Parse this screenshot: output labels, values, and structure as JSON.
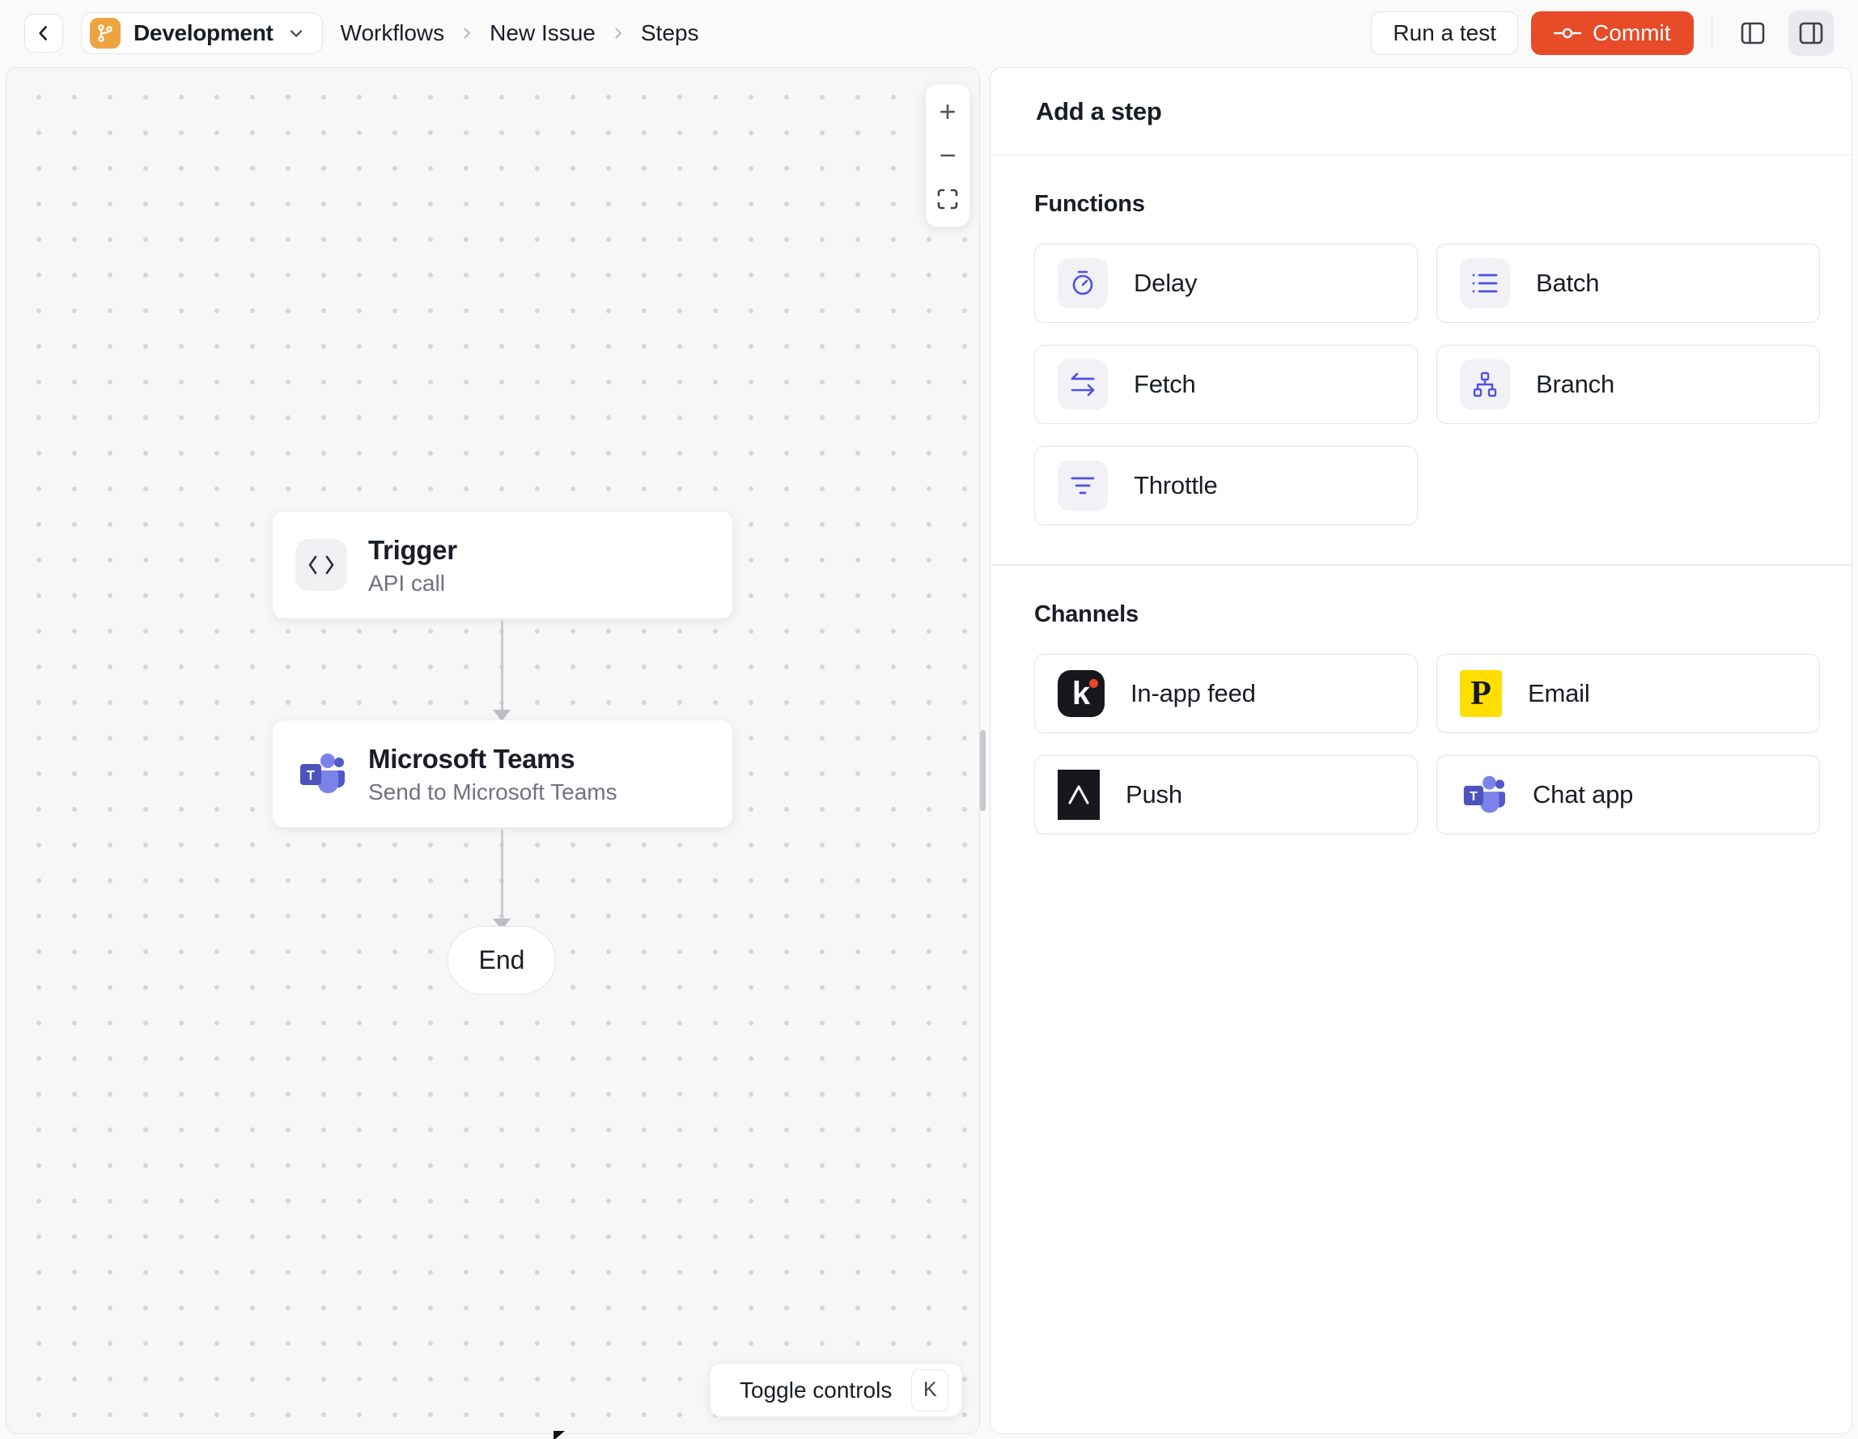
{
  "header": {
    "environment": "Development",
    "breadcrumb": {
      "items": [
        "Workflows",
        "New Issue",
        "Steps"
      ],
      "separator": "›"
    },
    "run_test_label": "Run a test",
    "commit_label": "Commit"
  },
  "canvas": {
    "zoom_in_label": "+",
    "zoom_out_label": "−",
    "nodes": {
      "trigger": {
        "title": "Trigger",
        "subtitle": "API call"
      },
      "teams": {
        "title": "Microsoft Teams",
        "subtitle": "Send to Microsoft Teams"
      },
      "end": {
        "label": "End"
      }
    },
    "toggle_controls": {
      "label": "Toggle controls",
      "shortcut": "K"
    }
  },
  "panel": {
    "title": "Add a step",
    "functions": {
      "label": "Functions",
      "items": [
        {
          "label": "Delay",
          "icon": "stopwatch-icon"
        },
        {
          "label": "Batch",
          "icon": "list-icon"
        },
        {
          "label": "Fetch",
          "icon": "swap-arrows-icon"
        },
        {
          "label": "Branch",
          "icon": "tree-icon"
        },
        {
          "label": "Throttle",
          "icon": "funnel-icon"
        }
      ]
    },
    "channels": {
      "label": "Channels",
      "items": [
        {
          "label": "In-app feed",
          "icon": "knock-icon"
        },
        {
          "label": "Email",
          "icon": "postmark-icon"
        },
        {
          "label": "Push",
          "icon": "expo-icon"
        },
        {
          "label": "Chat app",
          "icon": "teams-icon"
        }
      ]
    }
  },
  "colors": {
    "commit_button": "#E74B27",
    "environment_badge": "#EDA440",
    "function_icon_accent": "#4F50E6",
    "knock_black": "#17181D",
    "knock_red": "#EB4628",
    "postmark_yellow": "#FFDE00",
    "teams_dark": "#4B53BC",
    "teams_mid": "#5059C9",
    "teams_light": "#7B83EB",
    "canvas_background": "#F7F7F8",
    "panel_background": "#FFFFFF"
  }
}
